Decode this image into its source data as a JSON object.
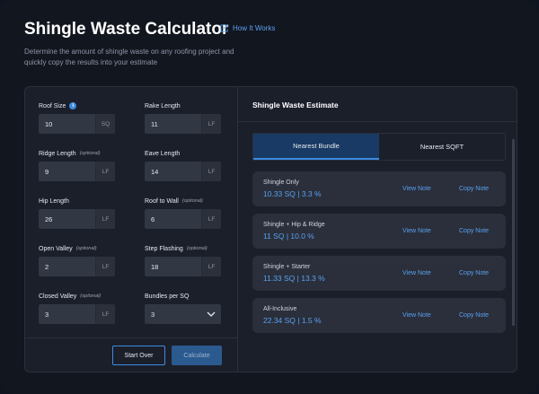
{
  "header": {
    "title": "Shingle Waste Calculator",
    "how_it_works": "How It Works",
    "subtitle": "Determine the amount of shingle waste on any roofing project and quickly copy the results into your estimate"
  },
  "fields": {
    "roof_size": {
      "label": "Roof Size",
      "value": "10",
      "unit": "SQ"
    },
    "rake_length": {
      "label": "Rake Length",
      "value": "11",
      "unit": "LF"
    },
    "ridge_length": {
      "label": "Ridge Length",
      "optional": "(optional)",
      "value": "9",
      "unit": "LF"
    },
    "eave_length": {
      "label": "Eave Length",
      "value": "14",
      "unit": "LF"
    },
    "hip_length": {
      "label": "Hip Length",
      "value": "26",
      "unit": "LF"
    },
    "roof_to_wall": {
      "label": "Roof to Wall",
      "optional": "(optional)",
      "value": "6",
      "unit": "LF"
    },
    "open_valley": {
      "label": "Open Valley",
      "optional": "(optional)",
      "value": "2",
      "unit": "LF"
    },
    "step_flashing": {
      "label": "Step Flashing",
      "optional": "(optional)",
      "value": "18",
      "unit": "LF"
    },
    "closed_valley": {
      "label": "Closed Valley",
      "optional": "(optional)",
      "value": "3",
      "unit": "LF"
    },
    "bundles_per_sq": {
      "label": "Bundles per SQ",
      "value": "3"
    }
  },
  "buttons": {
    "start_over": "Start Over",
    "calculate": "Calculate"
  },
  "estimate": {
    "title": "Shingle Waste Estimate",
    "tabs": [
      "Nearest Bundle",
      "Nearest SQFT"
    ],
    "results": [
      {
        "name": "Shingle Only",
        "value": "10.33 SQ | 3.3 %",
        "view": "View Note",
        "copy": "Copy Note"
      },
      {
        "name": "Shingle + Hip & Ridge",
        "value": "11 SQ | 10.0 %",
        "view": "View Note",
        "copy": "Copy Note"
      },
      {
        "name": "Shingle + Starter",
        "value": "11.33 SQ | 13.3 %",
        "view": "View Note",
        "copy": "Copy Note"
      },
      {
        "name": "All-Inclusive",
        "value": "22.34 SQ | 1.5 %",
        "view": "View Note",
        "copy": "Copy Note"
      }
    ]
  },
  "colors": {
    "accent": "#3d8be0",
    "link": "#5aa0ef",
    "background": "#12161f",
    "panel": "#1b1f2a"
  },
  "icons": {
    "how_it_works": "external-link-icon",
    "info": "info-icon",
    "dropdown": "chevron-down-icon"
  }
}
